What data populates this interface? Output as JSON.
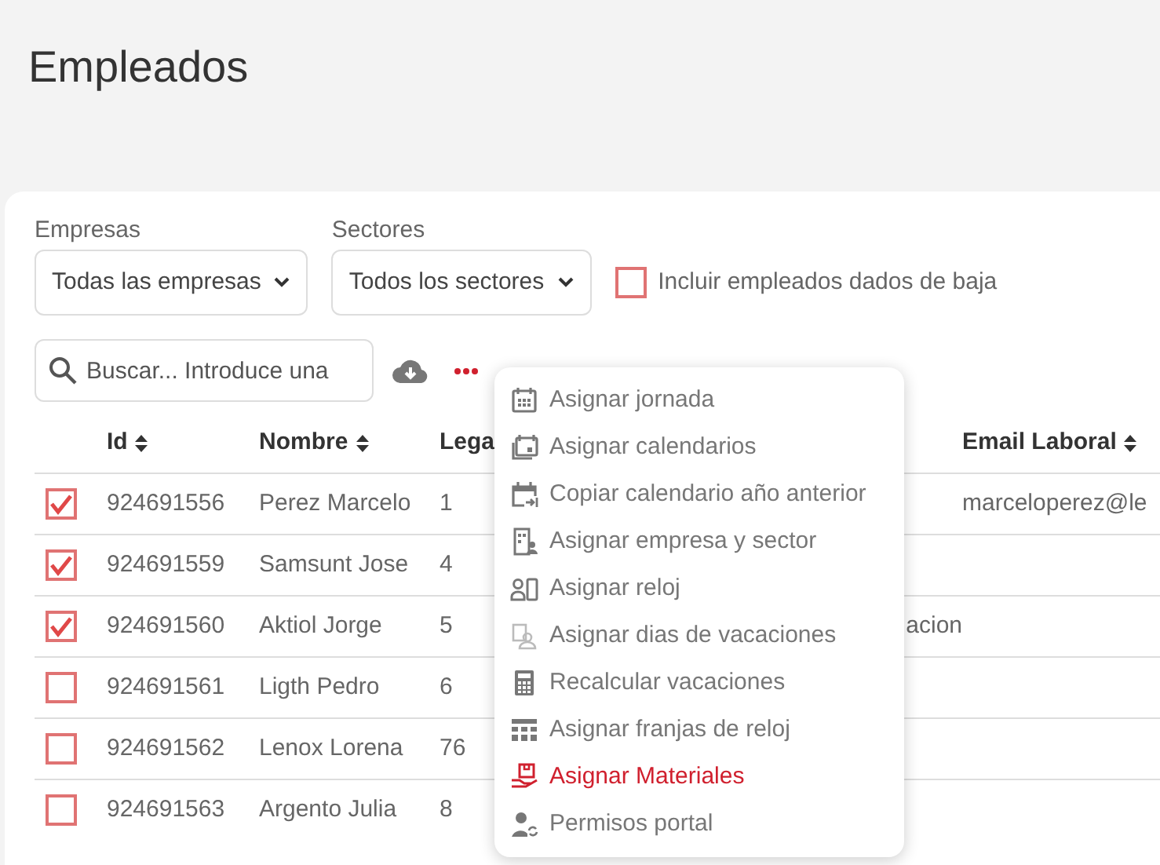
{
  "page": {
    "title": "Empleados"
  },
  "filters": [
    {
      "label": "Empresas",
      "value": "Todas las empresas"
    },
    {
      "label": "Sectores",
      "value": "Todos los sectores"
    }
  ],
  "include_inactive": {
    "label": "Incluir empleados dados de baja",
    "checked": false
  },
  "search": {
    "placeholder": "Buscar... Introduce una"
  },
  "table": {
    "columns": [
      {
        "label": "Id",
        "sortable": true
      },
      {
        "label": "Nombre",
        "sortable": true
      },
      {
        "label": "Lega",
        "sortable": false
      },
      {},
      {
        "label": "Email Laboral",
        "sortable": true
      }
    ],
    "rows": [
      {
        "selected": true,
        "cells": [
          "924691556",
          "Perez Marcelo",
          "1",
          null,
          "marceloperez@le"
        ]
      },
      {
        "selected": true,
        "cells": [
          "924691559",
          "Samsunt Jose",
          "4",
          null,
          null
        ]
      },
      {
        "selected": true,
        "cells": [
          "924691560",
          "Aktiol Jorge",
          "5",
          "acion",
          null
        ]
      },
      {
        "selected": false,
        "cells": [
          "924691561",
          "Ligth Pedro",
          "6",
          null,
          null
        ]
      },
      {
        "selected": false,
        "cells": [
          "924691562",
          "Lenox Lorena",
          "76",
          null,
          null
        ]
      },
      {
        "selected": false,
        "cells": [
          "924691563",
          "Argento Julia",
          "8",
          null,
          null
        ]
      }
    ]
  },
  "actions_menu": {
    "items": [
      {
        "label": "Asignar jornada",
        "kind": "calendar",
        "highlighted": false
      },
      {
        "label": "Asignar calendarios",
        "kind": "calendars",
        "highlighted": false
      },
      {
        "label": "Copiar calendario año anterior",
        "kind": "calendar-copy",
        "highlighted": false
      },
      {
        "label": "Asignar empresa y sector",
        "kind": "building",
        "highlighted": false
      },
      {
        "label": "Asignar reloj",
        "kind": "person-device",
        "highlighted": false
      },
      {
        "label": "Asignar dias de vacaciones",
        "kind": "clipboard",
        "highlighted": false
      },
      {
        "label": "Recalcular vacaciones",
        "kind": "calculator",
        "highlighted": false
      },
      {
        "label": "Asignar franjas de reloj",
        "kind": "grid",
        "highlighted": false
      },
      {
        "label": "Asignar Materiales",
        "kind": "hand-box",
        "highlighted": true
      },
      {
        "label": "Permisos portal",
        "kind": "person-sync",
        "highlighted": false
      }
    ]
  }
}
